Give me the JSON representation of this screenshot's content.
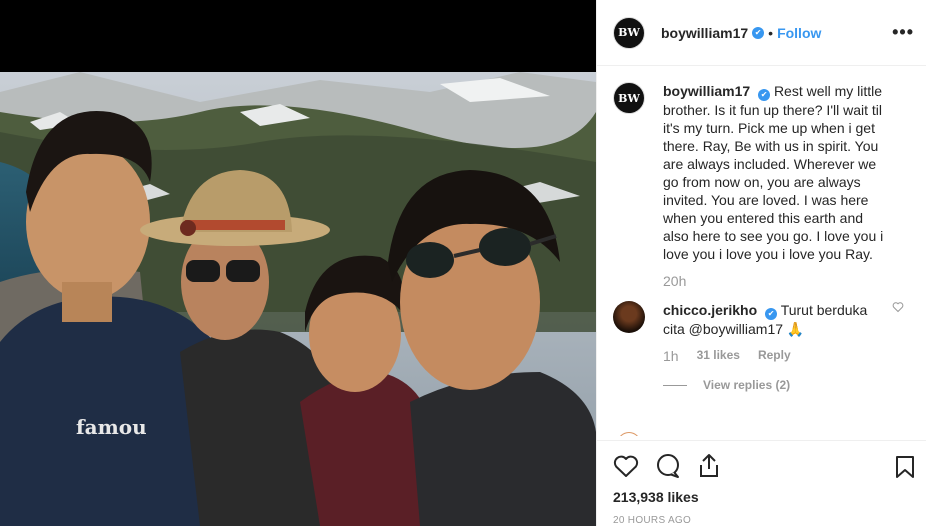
{
  "post": {
    "author": "boywilliam17",
    "avatar_text": "BW",
    "verified_mark": "✔",
    "separator": "•",
    "follow_label": "Follow",
    "more_label": "•••",
    "caption": "Rest well my little brother. Is it fun up there? I'll wait til it's my turn. Pick me up when i get there. Ray, Be with us in spirit. You are always included. Wherever we go from now on, you are always invited. You are loved. I was here when you entered this earth and also here to see you go. I love you i love you i love you i love you Ray.",
    "caption_time": "20h",
    "likes": "213,938 likes",
    "posted_ago": "20 HOURS AGO",
    "photo_shirt_text": "famou"
  },
  "comment": {
    "user": "chicco.jerikho",
    "text": "Turut berduka cita @boywilliam17 🙏",
    "time": "1h",
    "likes": "31 likes",
    "reply": "Reply",
    "view_replies": "View replies (2)"
  },
  "icons": {
    "heart": "heart-icon",
    "comment": "comment-icon",
    "share": "share-icon",
    "bookmark": "bookmark-icon",
    "comment_like": "small-heart-icon"
  },
  "colors": {
    "accent": "#3897f0",
    "muted": "#999999"
  }
}
